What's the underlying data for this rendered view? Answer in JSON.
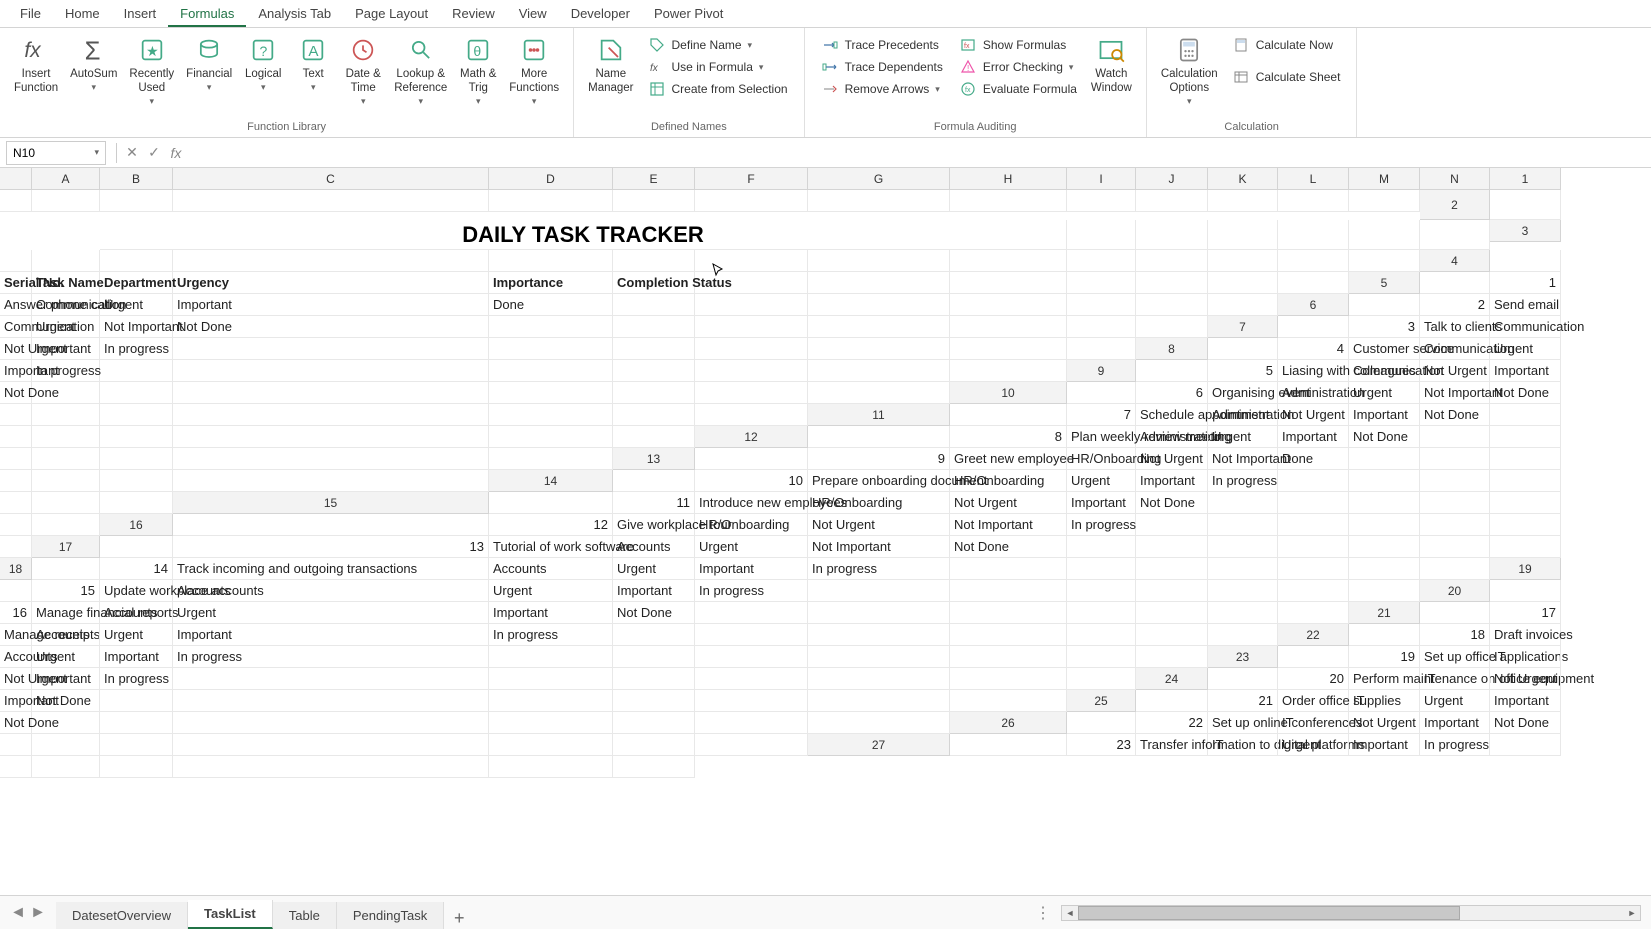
{
  "ribbon": {
    "tabs": [
      "File",
      "Home",
      "Insert",
      "Formulas",
      "Analysis Tab",
      "Page Layout",
      "Review",
      "View",
      "Developer",
      "Power Pivot"
    ],
    "activeTab": "Formulas",
    "groups": {
      "functionLibrary": {
        "label": "Function Library",
        "insert_function": "Insert\nFunction",
        "autosum": "AutoSum",
        "recently_used": "Recently\nUsed",
        "financial": "Financial",
        "logical": "Logical",
        "text": "Text",
        "date_time": "Date &\nTime",
        "lookup_ref": "Lookup &\nReference",
        "math_trig": "Math &\nTrig",
        "more_functions": "More\nFunctions"
      },
      "definedNames": {
        "label": "Defined Names",
        "name_manager": "Name\nManager",
        "define_name": "Define Name",
        "use_in_formula": "Use in Formula",
        "create_from_selection": "Create from Selection"
      },
      "formulaAuditing": {
        "label": "Formula Auditing",
        "trace_precedents": "Trace Precedents",
        "trace_dependents": "Trace Dependents",
        "remove_arrows": "Remove Arrows",
        "show_formulas": "Show Formulas",
        "error_checking": "Error Checking",
        "evaluate_formula": "Evaluate Formula",
        "watch_window": "Watch\nWindow"
      },
      "calculation": {
        "label": "Calculation",
        "calculation_options": "Calculation\nOptions",
        "calculate_now": "Calculate Now",
        "calculate_sheet": "Calculate Sheet"
      }
    }
  },
  "formulaBar": {
    "nameBox": "N10",
    "formulaInput": ""
  },
  "columns": [
    "A",
    "B",
    "C",
    "D",
    "E",
    "F",
    "G",
    "H",
    "I",
    "J",
    "K",
    "L",
    "M",
    "N"
  ],
  "sheet": {
    "title": "DAILY TASK TRACKER",
    "headers": {
      "serial": "Serial No.",
      "taskName": "Task Name",
      "department": "Department",
      "urgency": "Urgency",
      "importance": "Importance",
      "completion": "Completion Status"
    },
    "rows": [
      {
        "n": 1,
        "task": "Answer phone call",
        "dept": "Communication",
        "urg": "Urgent",
        "imp": "Important",
        "stat": "Done"
      },
      {
        "n": 2,
        "task": "Send email",
        "dept": "Communication",
        "urg": "Urgent",
        "imp": "Not Important",
        "stat": "Not Done"
      },
      {
        "n": 3,
        "task": "Talk to clients",
        "dept": "Communication",
        "urg": "Not Urgent",
        "imp": "Important",
        "stat": "In progress"
      },
      {
        "n": 4,
        "task": "Customer service",
        "dept": "Communication",
        "urg": "Urgent",
        "imp": "Important",
        "stat": "In progress"
      },
      {
        "n": 5,
        "task": "Liasing with colleagues",
        "dept": "Communication",
        "urg": "Not Urgent",
        "imp": "Important",
        "stat": "Not Done"
      },
      {
        "n": 6,
        "task": "Organising event",
        "dept": "Administration",
        "urg": "Urgent",
        "imp": "Not Important",
        "stat": "Not Done"
      },
      {
        "n": 7,
        "task": "Schedule appointment",
        "dept": "Administration",
        "urg": "Not Urgent",
        "imp": "Important",
        "stat": "Not Done"
      },
      {
        "n": 8,
        "task": "Plan weekly review meeting",
        "dept": "Administration",
        "urg": "Urgent",
        "imp": "Important",
        "stat": "Not Done"
      },
      {
        "n": 9,
        "task": "Greet new employee",
        "dept": "HR/Onboarding",
        "urg": "Not Urgent",
        "imp": "Not Important",
        "stat": "Done"
      },
      {
        "n": 10,
        "task": "Prepare onboarding document",
        "dept": "HR/Onboarding",
        "urg": "Urgent",
        "imp": "Important",
        "stat": "In progress"
      },
      {
        "n": 11,
        "task": "Introduce new employees",
        "dept": "HR/Onboarding",
        "urg": "Not Urgent",
        "imp": "Important",
        "stat": "Not Done"
      },
      {
        "n": 12,
        "task": "Give workplace tour",
        "dept": "HR/Onboarding",
        "urg": "Not Urgent",
        "imp": "Not Important",
        "stat": "In progress"
      },
      {
        "n": 13,
        "task": "Tutorial of work software",
        "dept": "Accounts",
        "urg": "Urgent",
        "imp": "Not Important",
        "stat": "Not Done"
      },
      {
        "n": 14,
        "task": "Track incoming and outgoing transactions",
        "dept": "Accounts",
        "urg": "Urgent",
        "imp": "Important",
        "stat": "In progress"
      },
      {
        "n": 15,
        "task": "Update workplace accounts",
        "dept": "Accounts",
        "urg": "Urgent",
        "imp": "Important",
        "stat": "In progress"
      },
      {
        "n": 16,
        "task": "Manage financial reports",
        "dept": "Accounts",
        "urg": "Urgent",
        "imp": "Important",
        "stat": "Not Done"
      },
      {
        "n": 17,
        "task": "Manage receipts",
        "dept": "Accounts",
        "urg": "Urgent",
        "imp": "Important",
        "stat": "In progress"
      },
      {
        "n": 18,
        "task": "Draft invoices",
        "dept": "Accounts",
        "urg": "Urgent",
        "imp": "Important",
        "stat": "In progress"
      },
      {
        "n": 19,
        "task": "Set up office applications",
        "dept": "IT",
        "urg": "Not Urgent",
        "imp": "Important",
        "stat": "In progress"
      },
      {
        "n": 20,
        "task": "Perform maintenance on office equipment",
        "dept": "IT",
        "urg": "Not Urgent",
        "imp": "Important",
        "stat": "Not Done"
      },
      {
        "n": 21,
        "task": "Order office supplies",
        "dept": "IT",
        "urg": "Urgent",
        "imp": "Important",
        "stat": "Not Done"
      },
      {
        "n": 22,
        "task": "Set up online conferences",
        "dept": "IT",
        "urg": "Not Urgent",
        "imp": "Important",
        "stat": "Not Done"
      },
      {
        "n": 23,
        "task": "Transfer information to digital platforms",
        "dept": "IT",
        "urg": "Urgent",
        "imp": "Important",
        "stat": "In progress"
      }
    ]
  },
  "sheetTabs": {
    "tabs": [
      "DatesetOverview",
      "TaskList",
      "Table",
      "PendingTask"
    ],
    "active": "TaskList"
  }
}
